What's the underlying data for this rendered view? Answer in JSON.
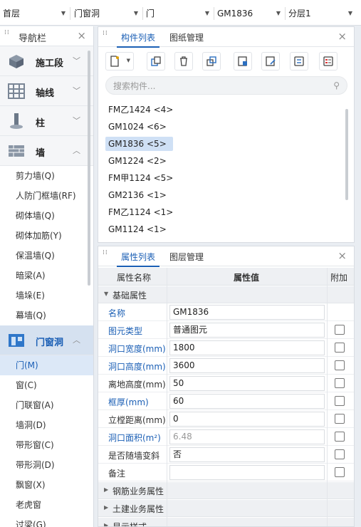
{
  "topbar": {
    "floor": "首层",
    "category": "门窗洞",
    "type": "门",
    "component": "GM1836",
    "layer": "分层1"
  },
  "nav": {
    "title": "导航栏",
    "categories": [
      {
        "label": "施工段"
      },
      {
        "label": "轴线"
      },
      {
        "label": "柱"
      },
      {
        "label": "墙"
      }
    ],
    "wall_items": [
      "剪力墙(Q)",
      "人防门框墙(RF)",
      "砌体墙(Q)",
      "砌体加筋(Y)",
      "保温墙(Q)",
      "暗梁(A)",
      "墙垛(E)",
      "幕墙(Q)"
    ],
    "active_category": "门窗洞",
    "door_items": [
      "门(M)",
      "窗(C)",
      "门联窗(A)",
      "墙洞(D)",
      "带形窗(C)",
      "带形洞(D)",
      "飘窗(X)",
      "老虎窗",
      "过梁(G)"
    ]
  },
  "components": {
    "tabs": [
      "构件列表",
      "图纸管理"
    ],
    "search_placeholder": "搜索构件...",
    "items": [
      "FM乙1424 <4>",
      "GM1024 <6>",
      "GM1836 <5>",
      "GM1224 <2>",
      "FM甲1124 <5>",
      "GM2136 <1>",
      "FM乙1124 <1>",
      "GM1124 <1>"
    ],
    "selected": "GM1836 <5>"
  },
  "props": {
    "tabs": [
      "属性列表",
      "图层管理"
    ],
    "headers": {
      "name": "属性名称",
      "value": "属性值",
      "extra": "附加"
    },
    "group_basic": "基础属性",
    "rows": [
      {
        "name": "名称",
        "value": "GM1836"
      },
      {
        "name": "图元类型",
        "value": "普通图元"
      },
      {
        "name": "洞口宽度(mm)",
        "value": "1800"
      },
      {
        "name": "洞口高度(mm)",
        "value": "3600"
      },
      {
        "name": "离地高度(mm)",
        "value": "50"
      },
      {
        "name": "框厚(mm)",
        "value": "60"
      },
      {
        "name": "立樘距离(mm)",
        "value": "0"
      },
      {
        "name": "洞口面积(m²)",
        "value": "6.48"
      },
      {
        "name": "是否随墙变斜",
        "value": "否"
      },
      {
        "name": "备注",
        "value": ""
      }
    ],
    "group_rebar": "钢筋业务属性",
    "group_civil": "土建业务属性",
    "group_display": "显示样式"
  },
  "colors": {
    "accent": "#1b5fb5",
    "selected_bg": "#cfe0f5"
  }
}
